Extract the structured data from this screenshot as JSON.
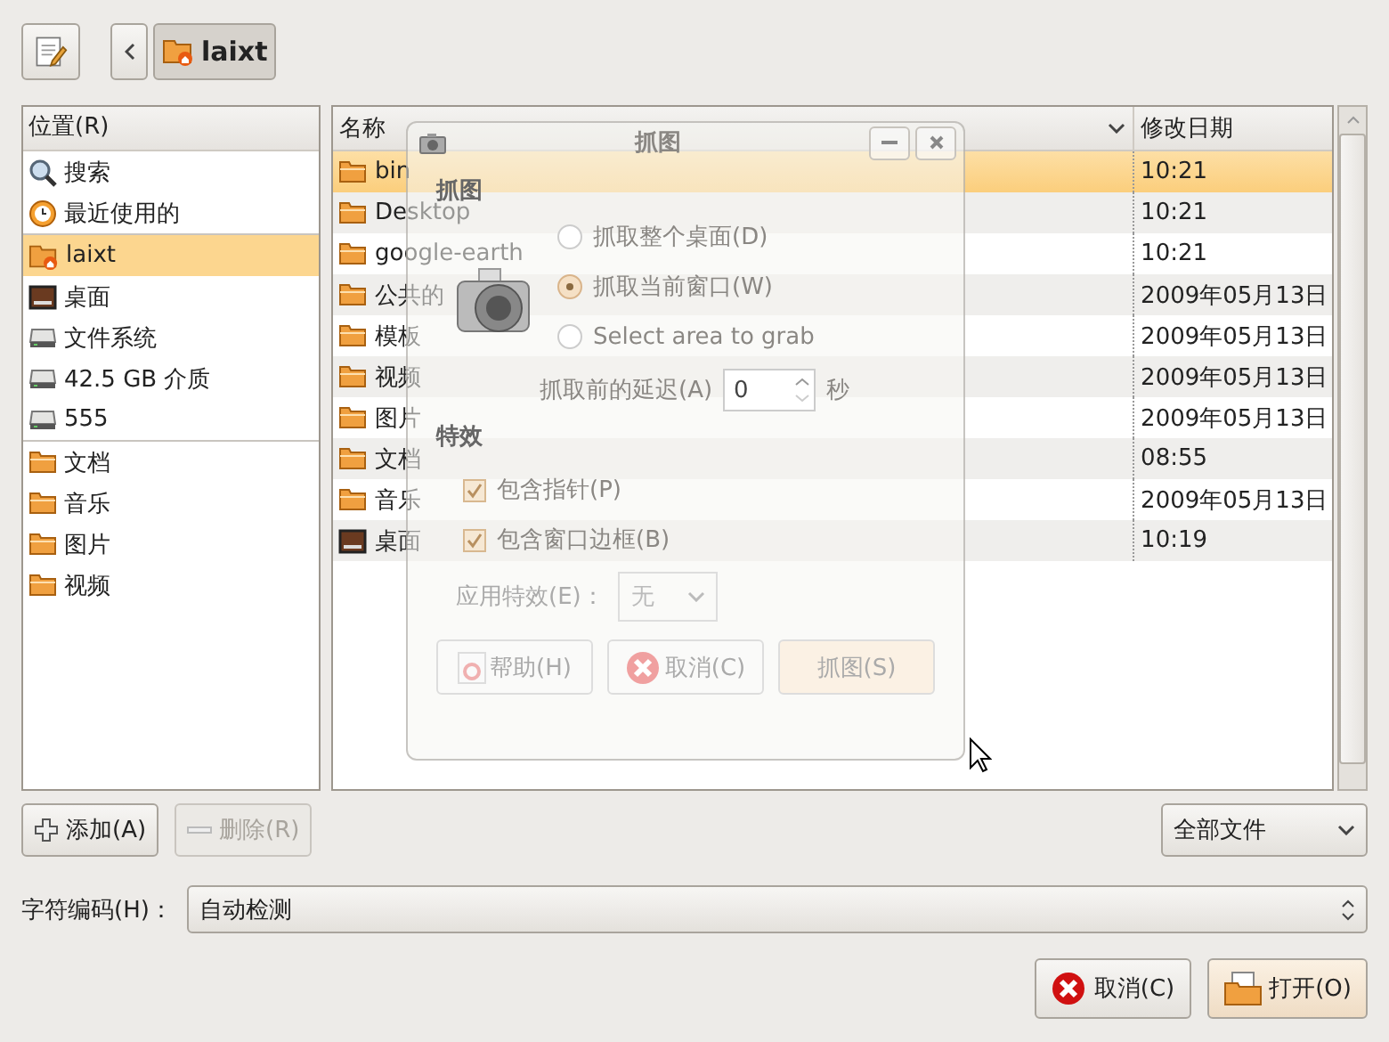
{
  "toolbar": {
    "path": [
      {
        "label": "laixt",
        "selected": true
      }
    ]
  },
  "places": {
    "header": "位置(R)",
    "sections": [
      [
        {
          "label": "搜索",
          "kind": "search",
          "selected": false
        },
        {
          "label": "最近使用的",
          "kind": "recent",
          "selected": false
        }
      ],
      [
        {
          "label": "laixt",
          "kind": "home",
          "selected": true
        },
        {
          "label": "桌面",
          "kind": "desktop",
          "selected": false
        },
        {
          "label": "文件系统",
          "kind": "drive",
          "selected": false
        },
        {
          "label": "42.5 GB 介质",
          "kind": "drive",
          "selected": false
        },
        {
          "label": "555",
          "kind": "drive",
          "selected": false
        }
      ],
      [
        {
          "label": "文档",
          "kind": "folder",
          "selected": false
        },
        {
          "label": "音乐",
          "kind": "folder",
          "selected": false
        },
        {
          "label": "图片",
          "kind": "folder",
          "selected": false
        },
        {
          "label": "视频",
          "kind": "folder",
          "selected": false
        }
      ]
    ]
  },
  "files": {
    "columns": [
      "名称",
      "修改日期"
    ],
    "rows": [
      {
        "name": "bin",
        "modified": "10:21",
        "kind": "folder",
        "selected": true
      },
      {
        "name": "Desktop",
        "modified": "10:21",
        "kind": "folder",
        "selected": false
      },
      {
        "name": "google-earth",
        "modified": "10:21",
        "kind": "folder",
        "selected": false
      },
      {
        "name": "公共的",
        "modified": "2009年05月13日",
        "kind": "folder",
        "selected": false
      },
      {
        "name": "模板",
        "modified": "2009年05月13日",
        "kind": "folder",
        "selected": false
      },
      {
        "name": "视频",
        "modified": "2009年05月13日",
        "kind": "folder",
        "selected": false
      },
      {
        "name": "图片",
        "modified": "2009年05月13日",
        "kind": "folder",
        "selected": false
      },
      {
        "name": "文档",
        "modified": "08:55",
        "kind": "folder",
        "selected": false
      },
      {
        "name": "音乐",
        "modified": "2009年05月13日",
        "kind": "folder",
        "selected": false
      },
      {
        "name": "桌面",
        "modified": "10:19",
        "kind": "desktop",
        "selected": false
      }
    ]
  },
  "add_button": {
    "label": "添加(A)",
    "disabled": false
  },
  "remove_button": {
    "label": "删除(R)",
    "disabled": true
  },
  "filter": {
    "value": "全部文件"
  },
  "encoding": {
    "label": "字符编码(H)：",
    "value": "自动检测"
  },
  "actions": [
    {
      "label": "取消(C)",
      "kind": "cancel"
    },
    {
      "label": "打开(O)",
      "kind": "open"
    }
  ],
  "screenshot_dialog": {
    "title": "抓图",
    "section_title": "抓图",
    "options": [
      {
        "label": "抓取整个桌面(D)",
        "selected": false
      },
      {
        "label": "抓取当前窗口(W)",
        "selected": true
      },
      {
        "label": "Select area to grab",
        "selected": false
      }
    ],
    "delay": {
      "label": "抓取前的延迟(A)",
      "value": "0",
      "unit": "秒"
    },
    "effects_title": "特效",
    "checks": [
      {
        "label": "包含指针(P)",
        "checked": true
      },
      {
        "label": "包含窗口边框(B)",
        "checked": true
      }
    ],
    "effect": {
      "label": "应用特效(E)：",
      "value": "无",
      "disabled": true
    },
    "buttons": [
      {
        "label": "帮助(H)",
        "kind": "help"
      },
      {
        "label": "取消(C)",
        "kind": "cancel"
      },
      {
        "label": "抓图(S)",
        "kind": "grab"
      }
    ]
  }
}
